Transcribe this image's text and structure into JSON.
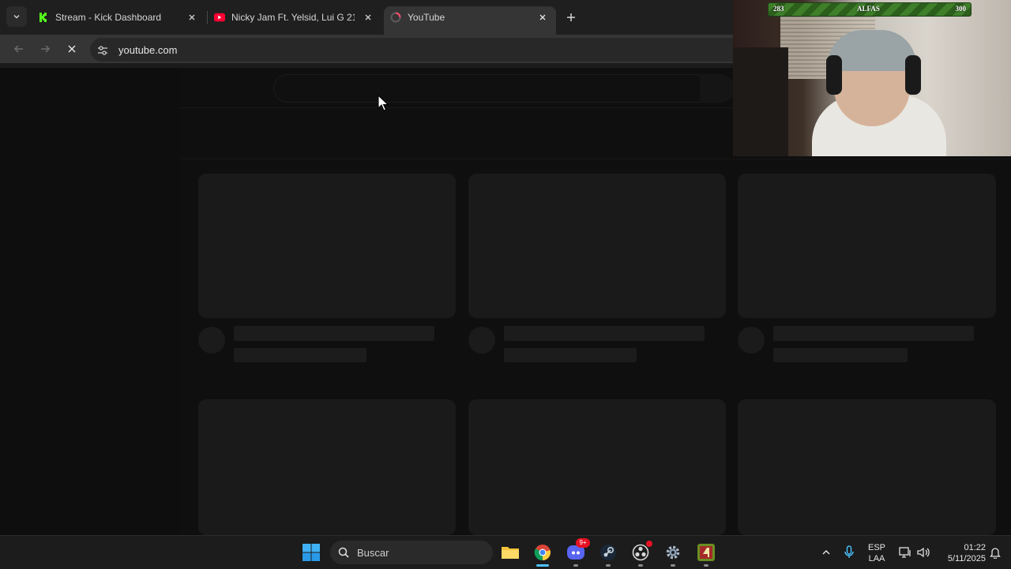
{
  "browser": {
    "tabs": [
      {
        "title": "Stream - Kick Dashboard",
        "favicon": "kick-favicon",
        "active": false
      },
      {
        "title": "Nicky Jam Ft. Yelsid, Lui G 21 Plu",
        "favicon": "youtube-favicon",
        "active": false
      },
      {
        "title": "YouTube",
        "favicon": "youtube-loading-favicon",
        "active": true
      }
    ],
    "url": "youtube.com",
    "icons": {
      "back": "arrow-left-icon",
      "forward": "arrow-right-icon",
      "stop": "close-icon",
      "site_info": "tune-icon",
      "new_tab": "plus-icon",
      "tab_list": "chevron-down-icon"
    }
  },
  "overlay": {
    "xp_left": "283",
    "xp_name": "ALFAS",
    "xp_right": "300"
  },
  "taskbar": {
    "search_label": "Buscar",
    "discord_badge": "9+",
    "language_top": "ESP",
    "language_bottom": "LAA",
    "time": "01:22",
    "date": "5/11/2025",
    "accent": "#4cc2ff"
  }
}
